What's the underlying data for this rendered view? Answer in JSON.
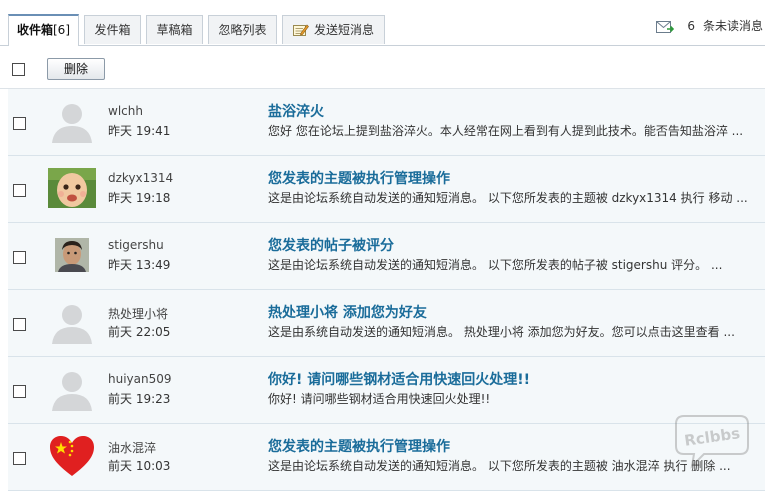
{
  "tabs": [
    {
      "label": "收件箱",
      "count": "[6]",
      "active": true
    },
    {
      "label": "发件箱"
    },
    {
      "label": "草稿箱"
    },
    {
      "label": "忽略列表"
    },
    {
      "label": "发送短消息"
    }
  ],
  "unread": {
    "count": "6",
    "label": "条未读消息"
  },
  "toolbar": {
    "delete_label": "删除"
  },
  "messages": [
    {
      "user": "wlchh",
      "time": "昨天  19:41",
      "subject": "盐浴淬火",
      "preview": "您好  您在论坛上提到盐浴淬火。本人经常在网上看到有人提到此技术。能否告知盐浴淬  ...",
      "avatar": "default-avatar"
    },
    {
      "user": "dzkyx1314",
      "time": "昨天  19:18",
      "subject": "您发表的主题被执行管理操作",
      "preview": "这是由论坛系统自动发送的通知短消息。  以下您所发表的主题被  dzkyx1314 执行  移动  ...",
      "avatar": "baby-photo-avatar"
    },
    {
      "user": "stigershu",
      "time": "昨天  13:49",
      "subject": "您发表的帖子被评分",
      "preview": "这是由论坛系统自动发送的通知短消息。  以下您所发表的帖子被  stigershu 评分。  ...",
      "avatar": "person-photo-avatar"
    },
    {
      "user": "热处理小将",
      "time": "前天  22:05",
      "subject": "热处理小将  添加您为好友",
      "preview": "这是由系统自动发送的通知短消息。  热处理小将  添加您为好友。您可以点击这里查看  ...",
      "avatar": "default-avatar"
    },
    {
      "user": "huiyan509",
      "time": "前天  19:23",
      "subject": "你好! 请问哪些钢材适合用快速回火处理!!",
      "preview": "你好! 请问哪些钢材适合用快速回火处理!!",
      "avatar": "default-avatar"
    },
    {
      "user": "油水混淬",
      "time": "前天  10:03",
      "subject": "您发表的主题被执行管理操作",
      "preview": "这是由论坛系统自动发送的通知短消息。  以下您所发表的主题被  油水混淬  执行  删除  ...",
      "avatar": "china-flag-heart-avatar"
    }
  ],
  "watermark": "Rclbbs",
  "colors": {
    "accent": "#1a6c9a",
    "row_bg": "#f4f8fa",
    "tab_border": "#c8d0d8"
  }
}
